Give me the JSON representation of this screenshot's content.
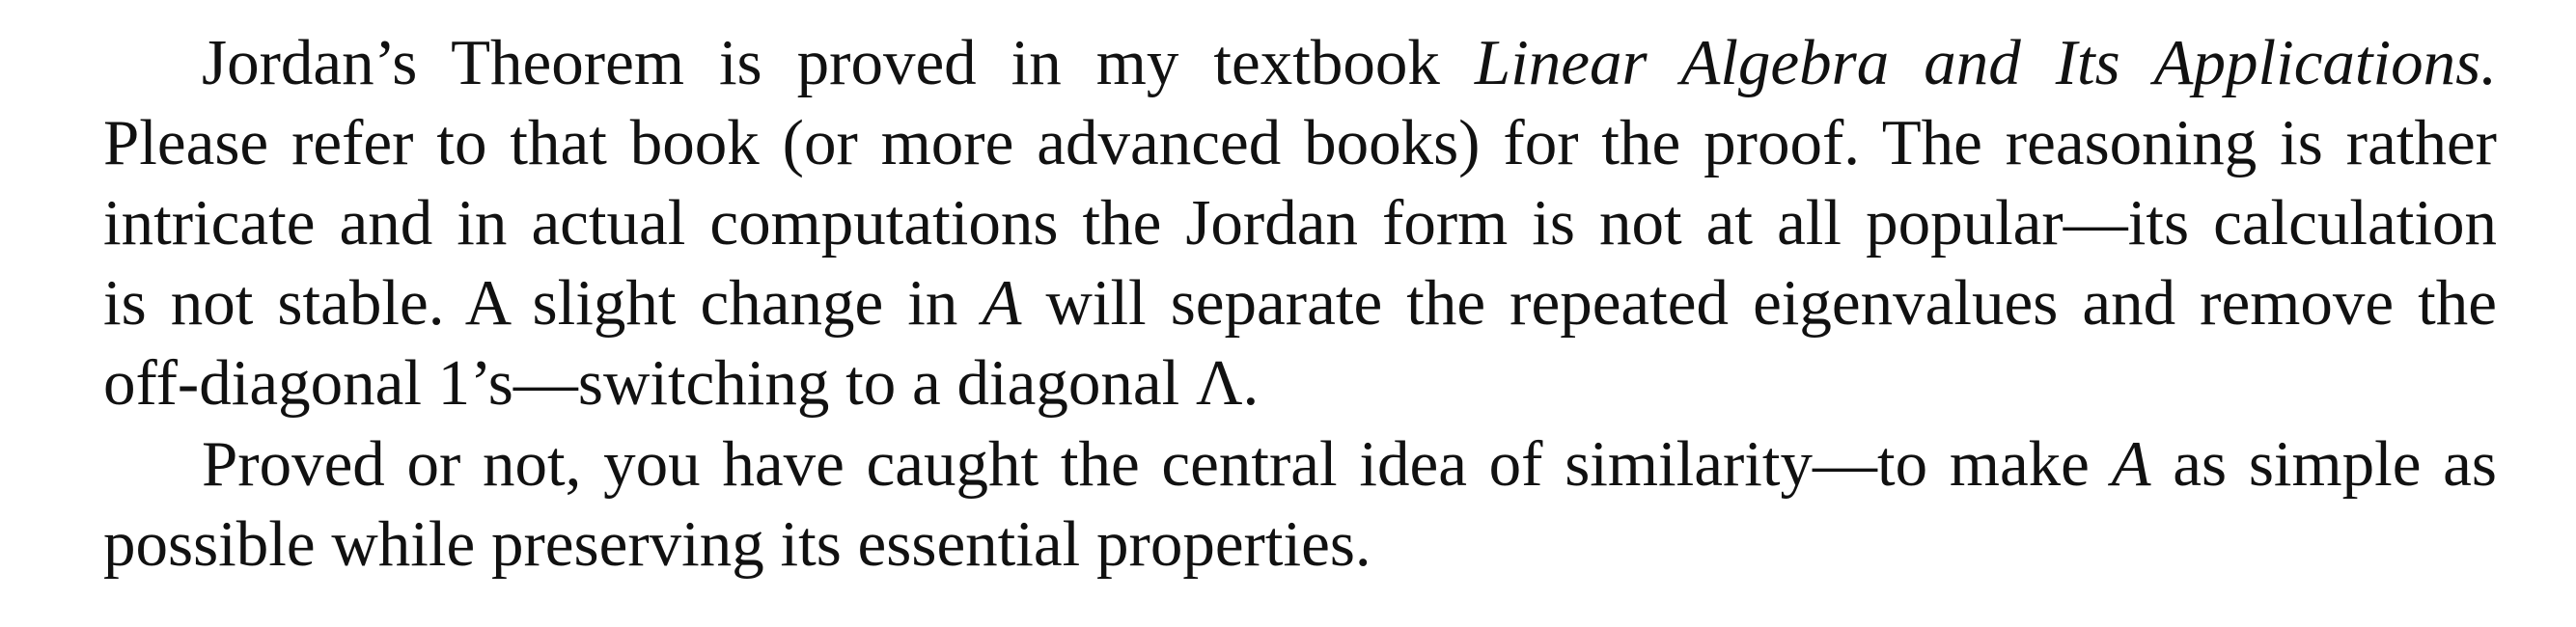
{
  "document": {
    "paragraphs": [
      {
        "lines": [
          {
            "segments": [
              {
                "text": "Jordan’s Theorem is proved in my textbook ",
                "italic": false
              },
              {
                "text": "Linear Algebra and Its Applications.",
                "italic": true
              }
            ]
          },
          {
            "segments": [
              {
                "text": "Please refer to that book (or more advanced books) for the proof. The reasoning is rather",
                "italic": false
              }
            ]
          },
          {
            "segments": [
              {
                "text": "intricate and in actual computations the Jordan form is not at all popular—its calculation",
                "italic": false
              }
            ]
          },
          {
            "segments": [
              {
                "text": "is not stable. A slight change in ",
                "italic": false
              },
              {
                "text": "A",
                "italic": true
              },
              {
                "text": " will separate the repeated eigenvalues and remove the",
                "italic": false
              }
            ]
          },
          {
            "segments": [
              {
                "text": "off-diagonal 1’s—switching to a diagonal Λ.",
                "italic": false
              }
            ]
          }
        ]
      },
      {
        "lines": [
          {
            "segments": [
              {
                "text": "Proved or not, you have caught the central idea of similarity—to make ",
                "italic": false
              },
              {
                "text": "A",
                "italic": true
              },
              {
                "text": " as simple as",
                "italic": false
              }
            ]
          },
          {
            "segments": [
              {
                "text": "possible while preserving its essential properties.",
                "italic": false
              }
            ]
          }
        ]
      }
    ]
  }
}
